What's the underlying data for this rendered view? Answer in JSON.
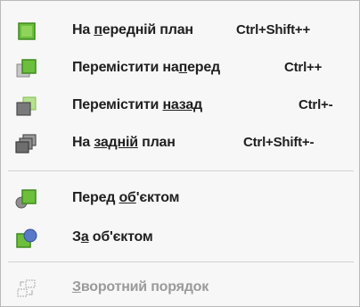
{
  "menu": {
    "items": [
      {
        "pre": "На ",
        "u": "п",
        "post": "ередній план",
        "shortcut": "Ctrl+Shift++",
        "icon": "bring-to-front-icon"
      },
      {
        "pre": "Перемістити на",
        "u": "п",
        "post": "еред",
        "shortcut": "Ctrl++",
        "icon": "bring-forward-icon"
      },
      {
        "pre": "Перемістити ",
        "u": "назад",
        "post": "",
        "shortcut": "Ctrl+-",
        "icon": "send-backward-icon"
      },
      {
        "pre": "На ",
        "u": "задній",
        "post": " план",
        "shortcut": "Ctrl+Shift+-",
        "icon": "send-to-back-icon"
      },
      {
        "pre": "Перед ",
        "u": "об",
        "post": "'єктом",
        "shortcut": "",
        "icon": "in-front-of-object-icon"
      },
      {
        "pre": "З",
        "u": "а",
        "post": " об'єктом",
        "shortcut": "",
        "icon": "behind-object-icon"
      },
      {
        "pre": "",
        "u": "З",
        "post": "воротний порядок",
        "shortcut": "",
        "icon": "reverse-order-icon"
      }
    ]
  },
  "colors": {
    "green": "#6cbf3c",
    "green_dark": "#3f8a1f",
    "gray": "#7a7a7a",
    "blue": "#5a78c8",
    "disabled": "#9a9a9a"
  }
}
